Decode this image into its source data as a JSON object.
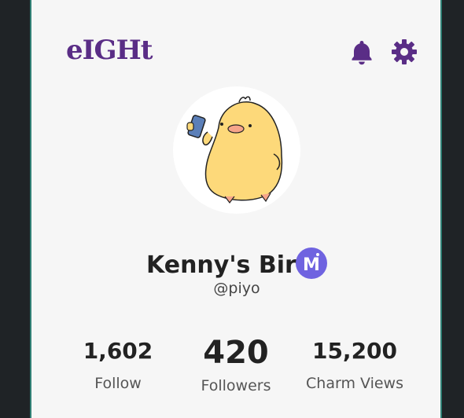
{
  "header": {
    "logo": "eIGHt",
    "bell_icon": "bell-icon",
    "settings_icon": "gear-icon",
    "accent_color": "#5a2d86"
  },
  "profile": {
    "name": "Kenny's Bird",
    "handle": "@piyo",
    "badge_letter": "M",
    "badge_color": "#6f63e0"
  },
  "stats": {
    "follow": {
      "value": "1,602",
      "label": "Follow"
    },
    "followers": {
      "value": "420",
      "label": "Followers"
    },
    "charm_views": {
      "value": "15,200",
      "label": "Charm Views"
    }
  }
}
